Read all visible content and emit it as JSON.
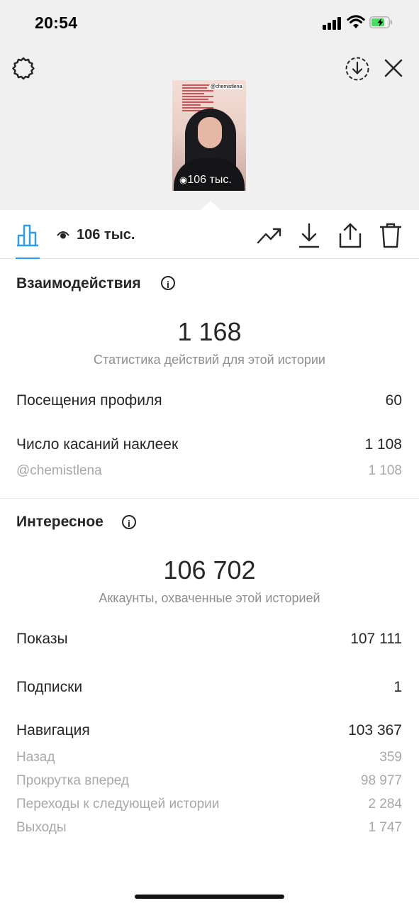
{
  "status": {
    "time": "20:54"
  },
  "preview": {
    "account_tag": "@chemistlena",
    "views_label": "106 тыс."
  },
  "toolbar": {
    "views": "106 тыс."
  },
  "interactions": {
    "title": "Взаимодействия",
    "total": "1 168",
    "caption": "Статистика действий для этой истории",
    "rows": [
      {
        "label": "Посещения профиля",
        "value": "60"
      },
      {
        "label": "Число касаний наклеек",
        "value": "1 108"
      },
      {
        "label": "@chemistlena",
        "value": "1 108"
      }
    ]
  },
  "discovery": {
    "title": "Интересное",
    "total": "106 702",
    "caption": "Аккаунты, охваченные этой историей",
    "rows": [
      {
        "label": "Показы",
        "value": "107 111"
      },
      {
        "label": "Подписки",
        "value": "1"
      },
      {
        "label": "Навигация",
        "value": "103 367"
      },
      {
        "label": "Назад",
        "value": "359"
      },
      {
        "label": "Прокрутка вперед",
        "value": "98 977"
      },
      {
        "label": "Переходы к следующей истории",
        "value": "2 284"
      },
      {
        "label": "Выходы",
        "value": "1 747"
      }
    ]
  },
  "colors": {
    "accent": "#2b9af3",
    "text": "#262626",
    "secondary": "#8e8e8e",
    "battery_green": "#4cd964"
  },
  "icons": [
    "gear-icon",
    "download-circle-icon",
    "close-icon",
    "insights-bar-icon",
    "eye-icon",
    "trend-icon",
    "download-icon",
    "share-icon",
    "trash-icon"
  ]
}
